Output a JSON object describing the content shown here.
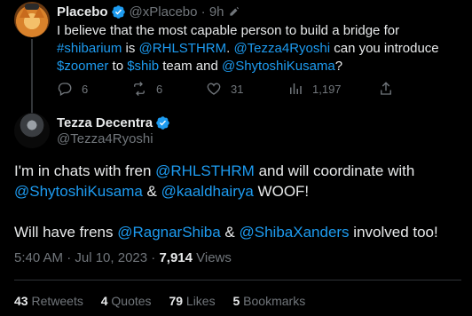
{
  "parent": {
    "name": "Placebo",
    "handle": "@xPlacebo",
    "time": "9h",
    "text": [
      {
        "t": "I believe that the most capable person to build a bridge for ",
        "link": false
      },
      {
        "t": "#shibarium",
        "link": true
      },
      {
        "t": " is ",
        "link": false
      },
      {
        "t": "@RHLSTHRM",
        "link": true
      },
      {
        "t": ". ",
        "link": false
      },
      {
        "t": "@Tezza4Ryoshi",
        "link": true
      },
      {
        "t": " can you introduce ",
        "link": false
      },
      {
        "t": "$zoomer",
        "link": true
      },
      {
        "t": " to ",
        "link": false
      },
      {
        "t": "$shib",
        "link": true
      },
      {
        "t": " team and ",
        "link": false
      },
      {
        "t": "@ShytoshiKusama",
        "link": true
      },
      {
        "t": "?",
        "link": false
      }
    ],
    "actions": {
      "replies": "6",
      "retweets": "6",
      "likes": "31",
      "views": "1,197"
    }
  },
  "main": {
    "name": "Tezza Decentra",
    "handle": "@Tezza4Ryoshi",
    "para1": [
      {
        "t": "I'm in chats with fren ",
        "link": false
      },
      {
        "t": "@RHLSTHRM",
        "link": true
      },
      {
        "t": " and will coordinate with ",
        "link": false
      },
      {
        "t": "@ShytoshiKusama",
        "link": true
      },
      {
        "t": " & ",
        "link": false
      },
      {
        "t": "@kaaldhairya",
        "link": true
      },
      {
        "t": " WOOF!",
        "link": false
      }
    ],
    "para2": [
      {
        "t": "Will have frens ",
        "link": false
      },
      {
        "t": "@RagnarShiba",
        "link": true
      },
      {
        "t": " & ",
        "link": false
      },
      {
        "t": "@ShibaXanders",
        "link": true
      },
      {
        "t": " involved too!",
        "link": false
      }
    ],
    "timestamp": "5:40 AM · Jul 10, 2023 · ",
    "views_count": "7,914",
    "views_label": " Views",
    "stats": [
      {
        "n": "43",
        "label": "Retweets"
      },
      {
        "n": "4",
        "label": "Quotes"
      },
      {
        "n": "79",
        "label": "Likes"
      },
      {
        "n": "5",
        "label": "Bookmarks"
      }
    ]
  },
  "colors": {
    "accent": "#1d9bf0",
    "muted": "#71767b",
    "text": "#e7e9ea",
    "bg": "#000000"
  }
}
